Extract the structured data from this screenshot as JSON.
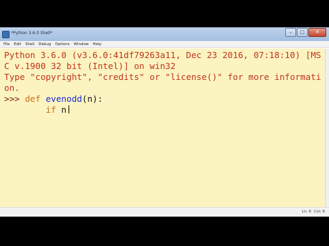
{
  "window": {
    "title": "*Python 3.6.0 Shell*"
  },
  "titlebar_buttons": {
    "minimize": "–",
    "maximize": "□",
    "close": "✕"
  },
  "menu": [
    "File",
    "Edit",
    "Shell",
    "Debug",
    "Options",
    "Window",
    "Help"
  ],
  "shell": {
    "banner": [
      "Python 3.6.0 (v3.6.0:41df79263a11, Dec 23 2016, 07:18:10) [MS",
      "C v.1900 32 bit (Intel)] on win32",
      "Type \"copyright\", \"credits\" or \"license()\" for more informati",
      "on."
    ],
    "line1": {
      "prompt": ">>> ",
      "keyword": "def",
      "space": " ",
      "func": "evenodd",
      "rest": "(n):"
    },
    "line2": {
      "indent": "        ",
      "keyword": "if",
      "rest": " n"
    }
  },
  "status": {
    "line": "Ln: 6",
    "col": "Col: 6"
  },
  "colors": {
    "editor_bg": "#fbf4c1",
    "output": "#c0321d",
    "keyword": "#cf6b17",
    "function": "#1a2bd0"
  }
}
